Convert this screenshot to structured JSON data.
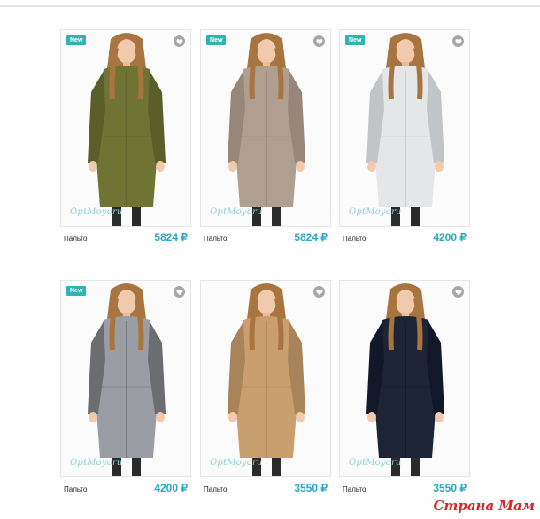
{
  "products": [
    {
      "name": "Пальто",
      "price": "5824 ₽",
      "badge": "New",
      "watermark": "OptMoyoru",
      "coat_color": "#6f7434",
      "coat_shade": "#5a5f29"
    },
    {
      "name": "Пальто",
      "price": "5824 ₽",
      "badge": "New",
      "watermark": "OptMoyoru",
      "coat_color": "#ae9f90",
      "coat_shade": "#96877a"
    },
    {
      "name": "Пальто",
      "price": "4200 ₽",
      "badge": "New",
      "watermark": "OptMoyoru",
      "coat_color": "#e4e6e8",
      "coat_shade": "#c2c5c8"
    },
    {
      "name": "Пальто",
      "price": "4200 ₽",
      "badge": "New",
      "watermark": "OptMoyoru",
      "coat_color": "#9a9ea4",
      "coat_shade": "#6b6d70"
    },
    {
      "name": "Пальто",
      "price": "3550 ₽",
      "badge": "",
      "watermark": "OptMoyoru",
      "coat_color": "#c99f70",
      "coat_shade": "#a9845a"
    },
    {
      "name": "Пальто",
      "price": "3550 ₽",
      "badge": "",
      "watermark": "OptMoyoru",
      "coat_color": "#1d2436",
      "coat_shade": "#121827"
    }
  ],
  "site_logo": "Страна Мам",
  "colors": {
    "accent": "#2fb5b0",
    "price": "#2aa8c4",
    "logo": "#d4252b"
  },
  "icons": {
    "favorite": "heart-icon"
  }
}
